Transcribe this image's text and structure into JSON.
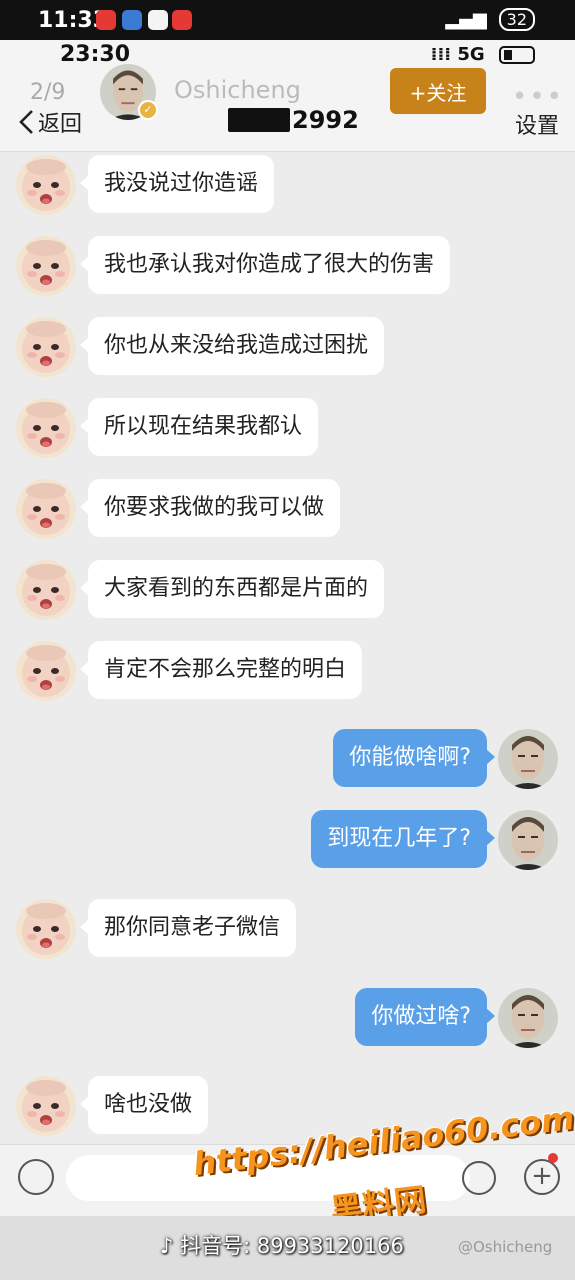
{
  "outer_status": {
    "time": "11:33",
    "battery": "32"
  },
  "inner_status": {
    "time": "23:30",
    "network": "5G"
  },
  "header": {
    "page_counter": "2/9",
    "back_label": "返回",
    "username": "Oshicheng",
    "follow_label": "+关注",
    "title_suffix": "2992",
    "settings_label": "设置"
  },
  "messages": [
    {
      "side": "left",
      "text": "我没说过你造谣"
    },
    {
      "side": "left",
      "text": "我也承认我对你造成了很大的伤害"
    },
    {
      "side": "left",
      "text": "你也从来没给我造成过困扰"
    },
    {
      "side": "left",
      "text": "所以现在结果我都认"
    },
    {
      "side": "left",
      "text": "你要求我做的我可以做"
    },
    {
      "side": "left",
      "text": "大家看到的东西都是片面的"
    },
    {
      "side": "left",
      "text": "肯定不会那么完整的明白"
    },
    {
      "side": "right",
      "text": "你能做啥啊?"
    },
    {
      "side": "right",
      "text": "到现在几年了?"
    },
    {
      "side": "left",
      "text": "那你同意老子微信"
    },
    {
      "side": "right",
      "text": "你做过啥?"
    },
    {
      "side": "left",
      "text": "啥也没做"
    }
  ],
  "watermark": {
    "url": "https://heiliao60.com",
    "name": "黑料网"
  },
  "footer": {
    "douyin_id": "抖音号: 89933120166",
    "weibo_handle": "@Oshicheng"
  },
  "colors": {
    "self_bubble": "#5aa0e8",
    "other_bubble": "#ffffff",
    "follow_button": "#c8821a",
    "watermark": "#f7941d"
  },
  "icons": [
    "back-chevron-icon",
    "verified-badge-icon",
    "more-icon",
    "voice-icon",
    "emoji-icon",
    "plus-icon",
    "douyin-logo-icon"
  ]
}
